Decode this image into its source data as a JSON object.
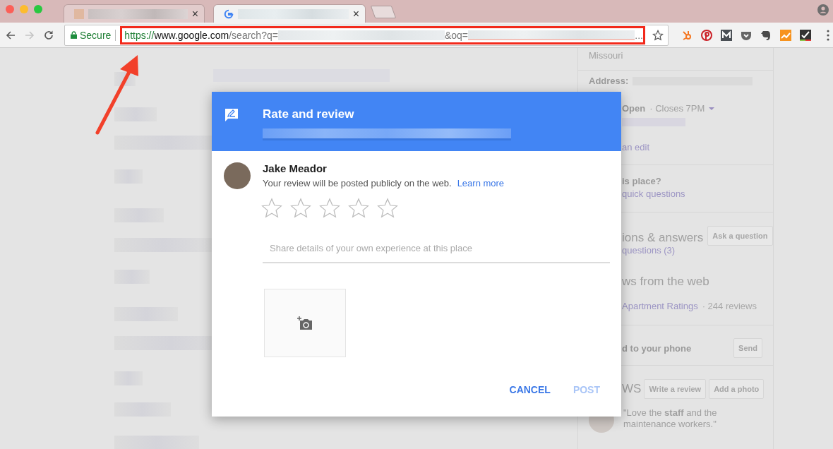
{
  "browser": {
    "tabs": [
      {
        "close": "×",
        "selected": false
      },
      {
        "close": "×",
        "selected": true
      }
    ],
    "nav": {
      "forward_disabled": true
    },
    "address_bar": {
      "security": "Secure",
      "scheme": "https://",
      "host": "www.google.com",
      "path": "/search?q=",
      "param": "&oq=",
      "overflow": "...",
      "annotated": true
    }
  },
  "knowledge_panel": {
    "rows": [
      {
        "kind": "text",
        "text": "Missouri"
      },
      {
        "kind": "label",
        "text": "Address:"
      },
      {
        "kind": "hours",
        "text": "Open",
        "detail": "· Closes 7PM"
      },
      {
        "kind": "link",
        "text": "an edit"
      },
      {
        "kind": "bold",
        "text": "is place?"
      },
      {
        "kind": "link",
        "text": "quick questions"
      },
      {
        "kind": "heading",
        "text": "ions & answers",
        "button": "Ask a question"
      },
      {
        "kind": "link",
        "text": "questions (3)"
      },
      {
        "kind": "heading",
        "text": "ws from the web"
      },
      {
        "kind": "source",
        "text": "Apartment Ratings",
        "detail": "· 244 reviews"
      },
      {
        "kind": "action",
        "text": "d to your phone",
        "button": "Send"
      },
      {
        "kind": "reviews",
        "text": "WS",
        "buttons": [
          "Write a review",
          "Add a photo"
        ]
      },
      {
        "kind": "quote",
        "text": "\"Love the **staff** and the maintenance workers.\""
      }
    ]
  },
  "review_dialog": {
    "title": "Rate and review",
    "user_name": "Jake Meador",
    "notice": "Your review will be posted publicly on the web.",
    "link": "Learn more",
    "stars": 0,
    "placeholder": "Share details of your own experience at this place",
    "buttons": [
      {
        "label": "CANCEL",
        "disabled": false
      },
      {
        "label": "POST",
        "disabled": true
      }
    ]
  }
}
